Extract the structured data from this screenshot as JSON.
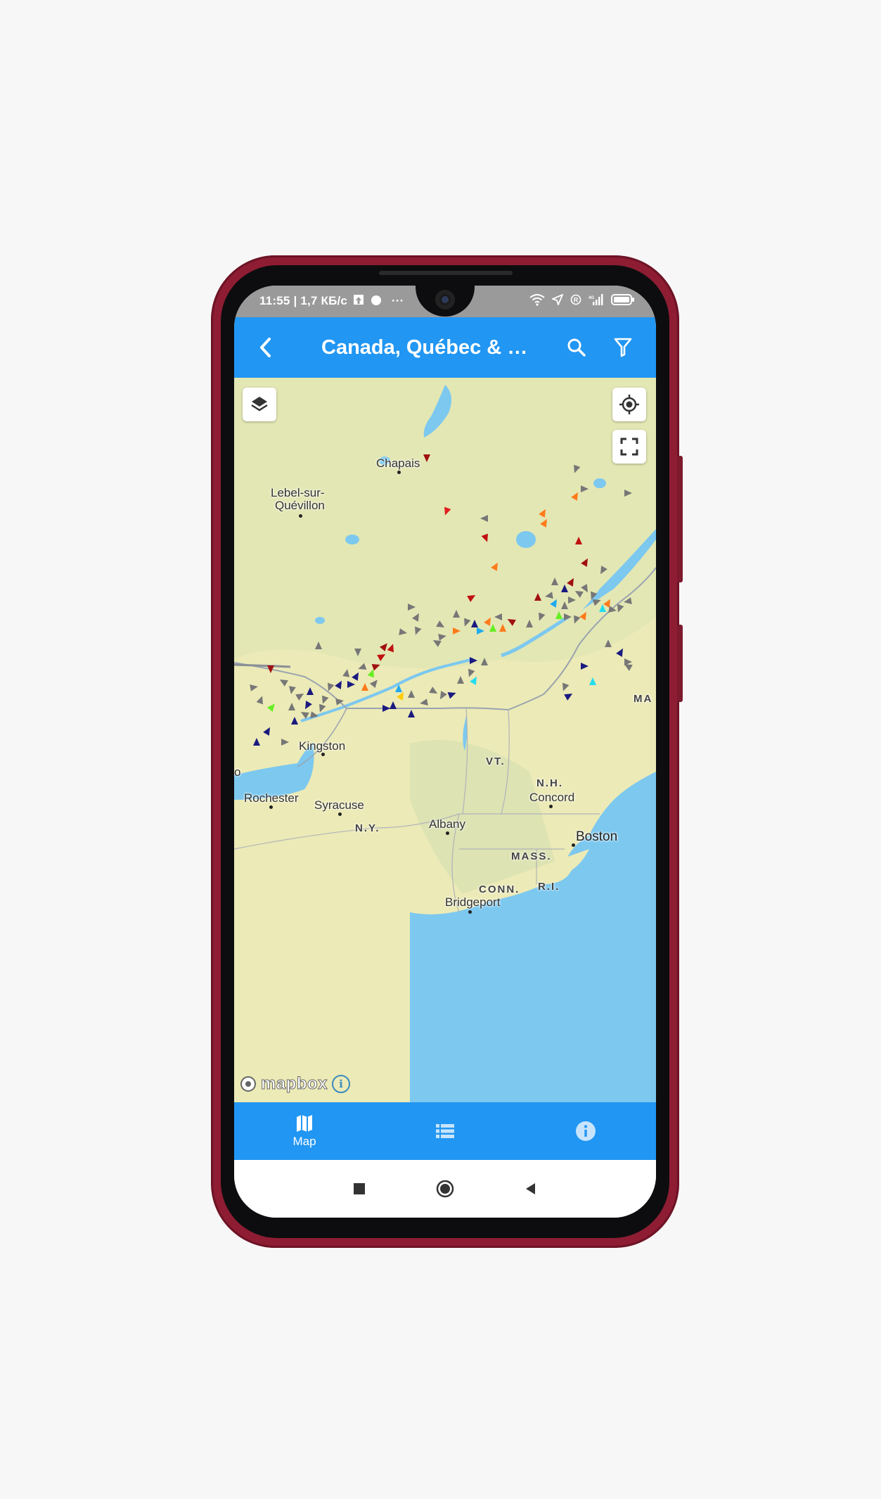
{
  "status_bar": {
    "time_speed": "11:55 | 1,7 КБ/с"
  },
  "app_bar": {
    "title": "Canada, Québec & On..."
  },
  "map": {
    "labels": {
      "chapais": "Chapais",
      "lebel_1": "Lebel-sur-",
      "lebel_2": "Quévillon",
      "kingston": "Kingston",
      "rochester": "Rochester",
      "syracuse": "Syracuse",
      "ny": "N.Y.",
      "albany": "Albany",
      "vt": "VT.",
      "nh": "N.H.",
      "concord": "Concord",
      "mass": "MASS.",
      "boston": "Boston",
      "conn": "CONN.",
      "ri": "R.I.",
      "bridgeport": "Bridgeport",
      "ma": "MA",
      "to": "o"
    },
    "attribution": "mapbox",
    "colors": {
      "land": "#eceab6",
      "forest": "#dde6b4",
      "water": "#7cc8ef",
      "border": "#9aa4b0"
    }
  },
  "fab": {
    "icon": "plus-icon"
  },
  "bottom_nav": {
    "map_label": "Map",
    "list_icon": "list-icon",
    "info_icon": "info-icon"
  },
  "theme": {
    "primary": "#2196f3",
    "accent": "#ff9800"
  }
}
